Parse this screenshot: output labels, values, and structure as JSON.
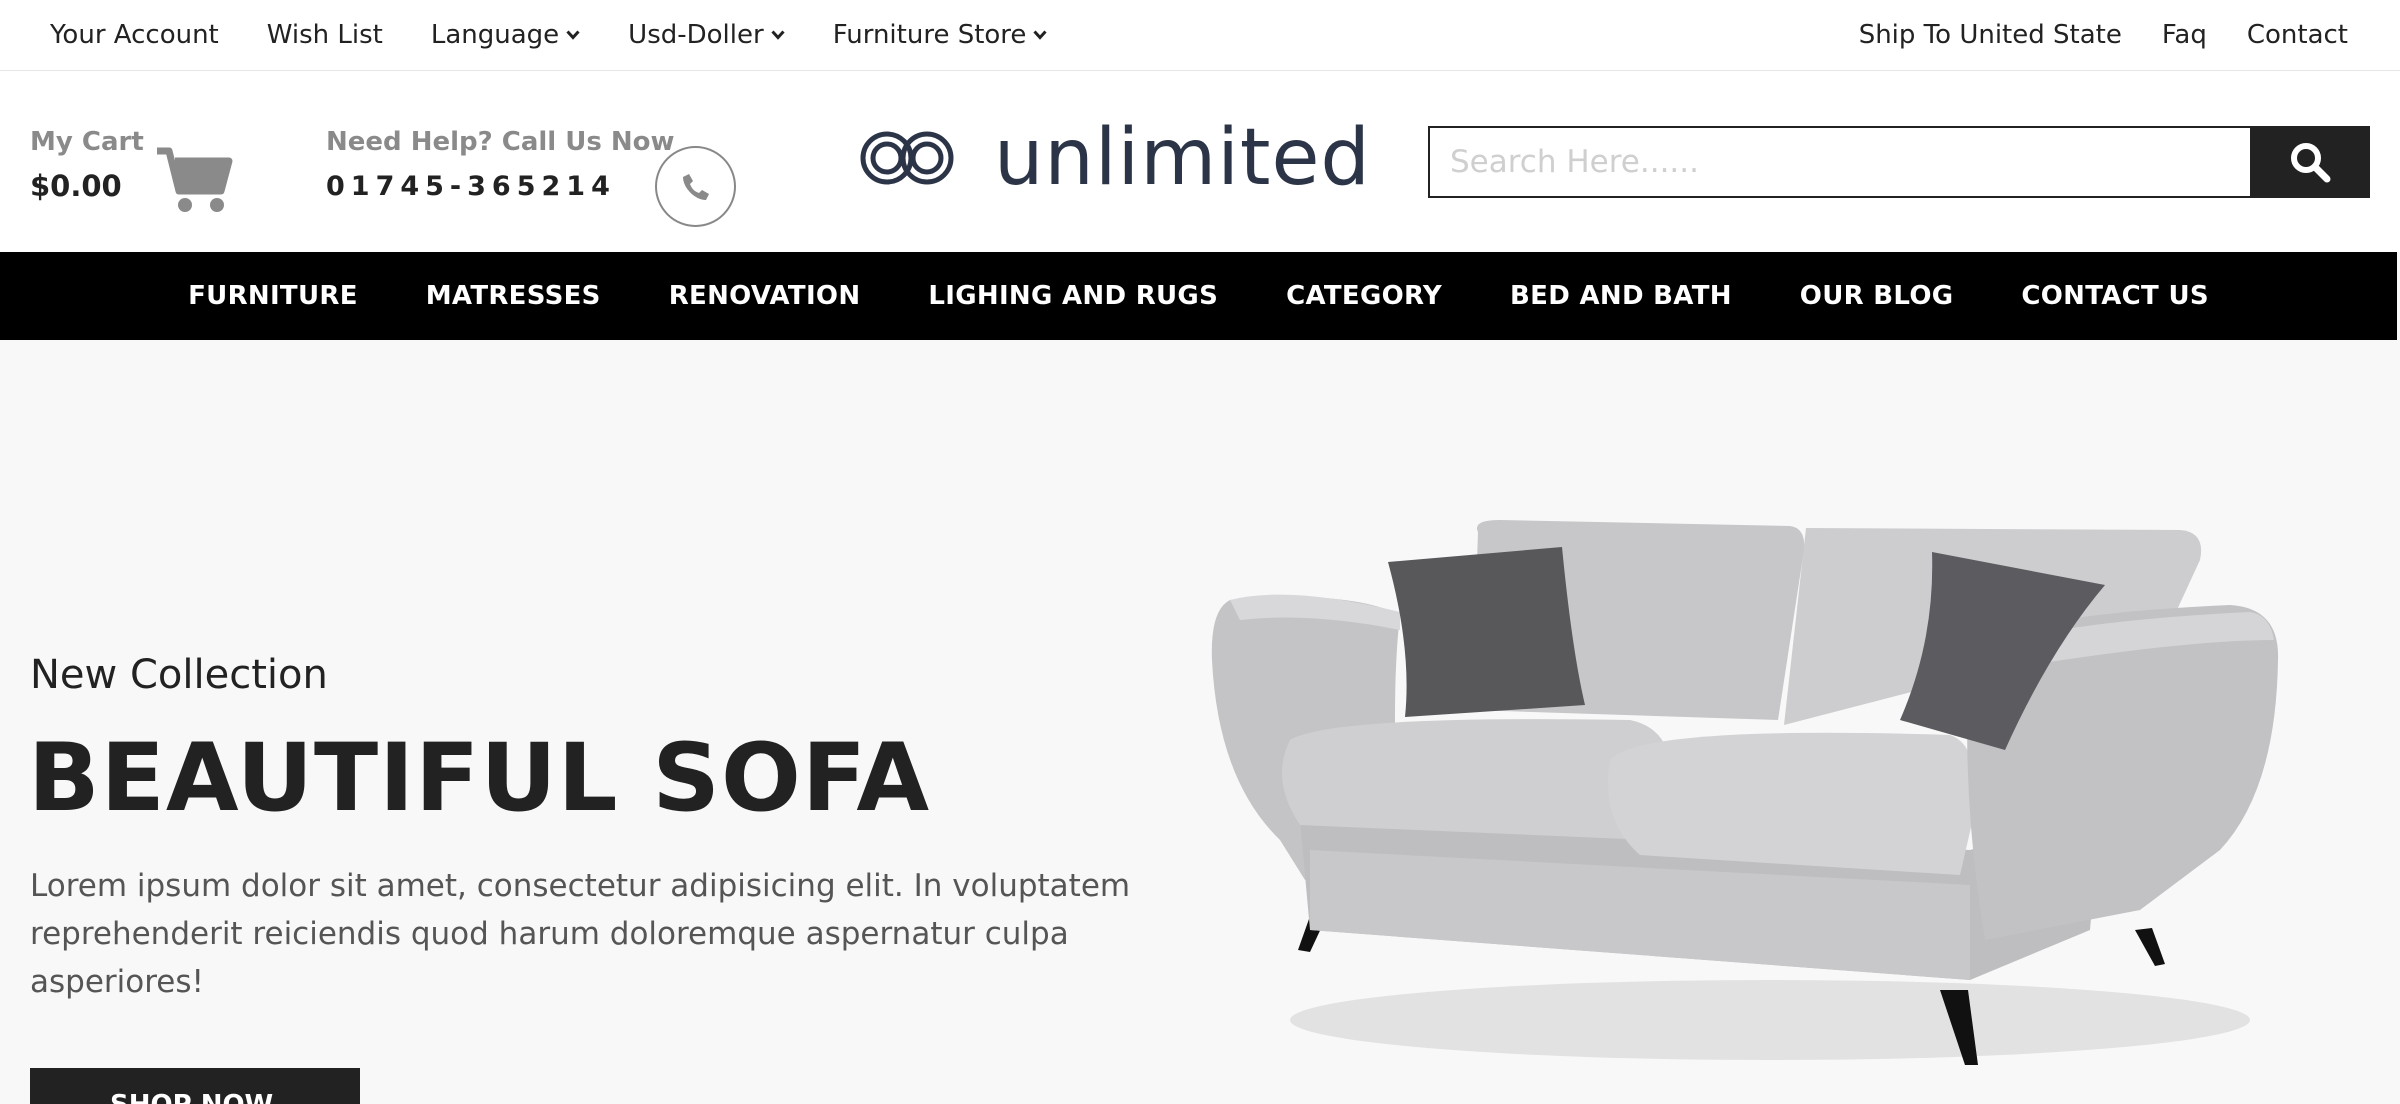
{
  "topbar": {
    "left": [
      {
        "label": "Your Account",
        "dropdown": false
      },
      {
        "label": "Wish List",
        "dropdown": false
      },
      {
        "label": "Language",
        "dropdown": true
      },
      {
        "label": "Usd-Doller",
        "dropdown": true
      },
      {
        "label": "Furniture Store",
        "dropdown": true
      }
    ],
    "right": [
      "Ship To United State",
      "Faq",
      "Contact"
    ]
  },
  "header": {
    "cart_label": "My Cart",
    "cart_amount": "$0.00",
    "help_label": "Need Help? Call Us Now",
    "phone": "01745-365214",
    "logo_text": "unlimited",
    "search_placeholder": "Search Here......"
  },
  "nav": [
    "FURNITURE",
    "MATRESSES",
    "RENOVATION",
    "LIGHING AND RUGS",
    "CATEGORY",
    "BED AND BATH",
    "OUR BLOG",
    "CONTACT US"
  ],
  "hero": {
    "subtitle": "New Collection",
    "headline": "BEAUTIFUL SOFA",
    "description": "Lorem ipsum dolor sit amet, consectetur adipisicing elit. In voluptatem reprehenderit reiciendis quod harum doloremque aspernatur culpa asperiores!",
    "button_label": "SHOP NOW"
  },
  "colors": {
    "accent": "#222222",
    "nav_bg": "#000000",
    "hero_bg": "#f8f8f8",
    "muted": "#8a8a8a",
    "logo": "#2c3547"
  },
  "icons": [
    "chevron-down-icon",
    "cart-icon",
    "phone-icon",
    "infinity-logo-icon",
    "search-icon",
    "sofa-image"
  ]
}
